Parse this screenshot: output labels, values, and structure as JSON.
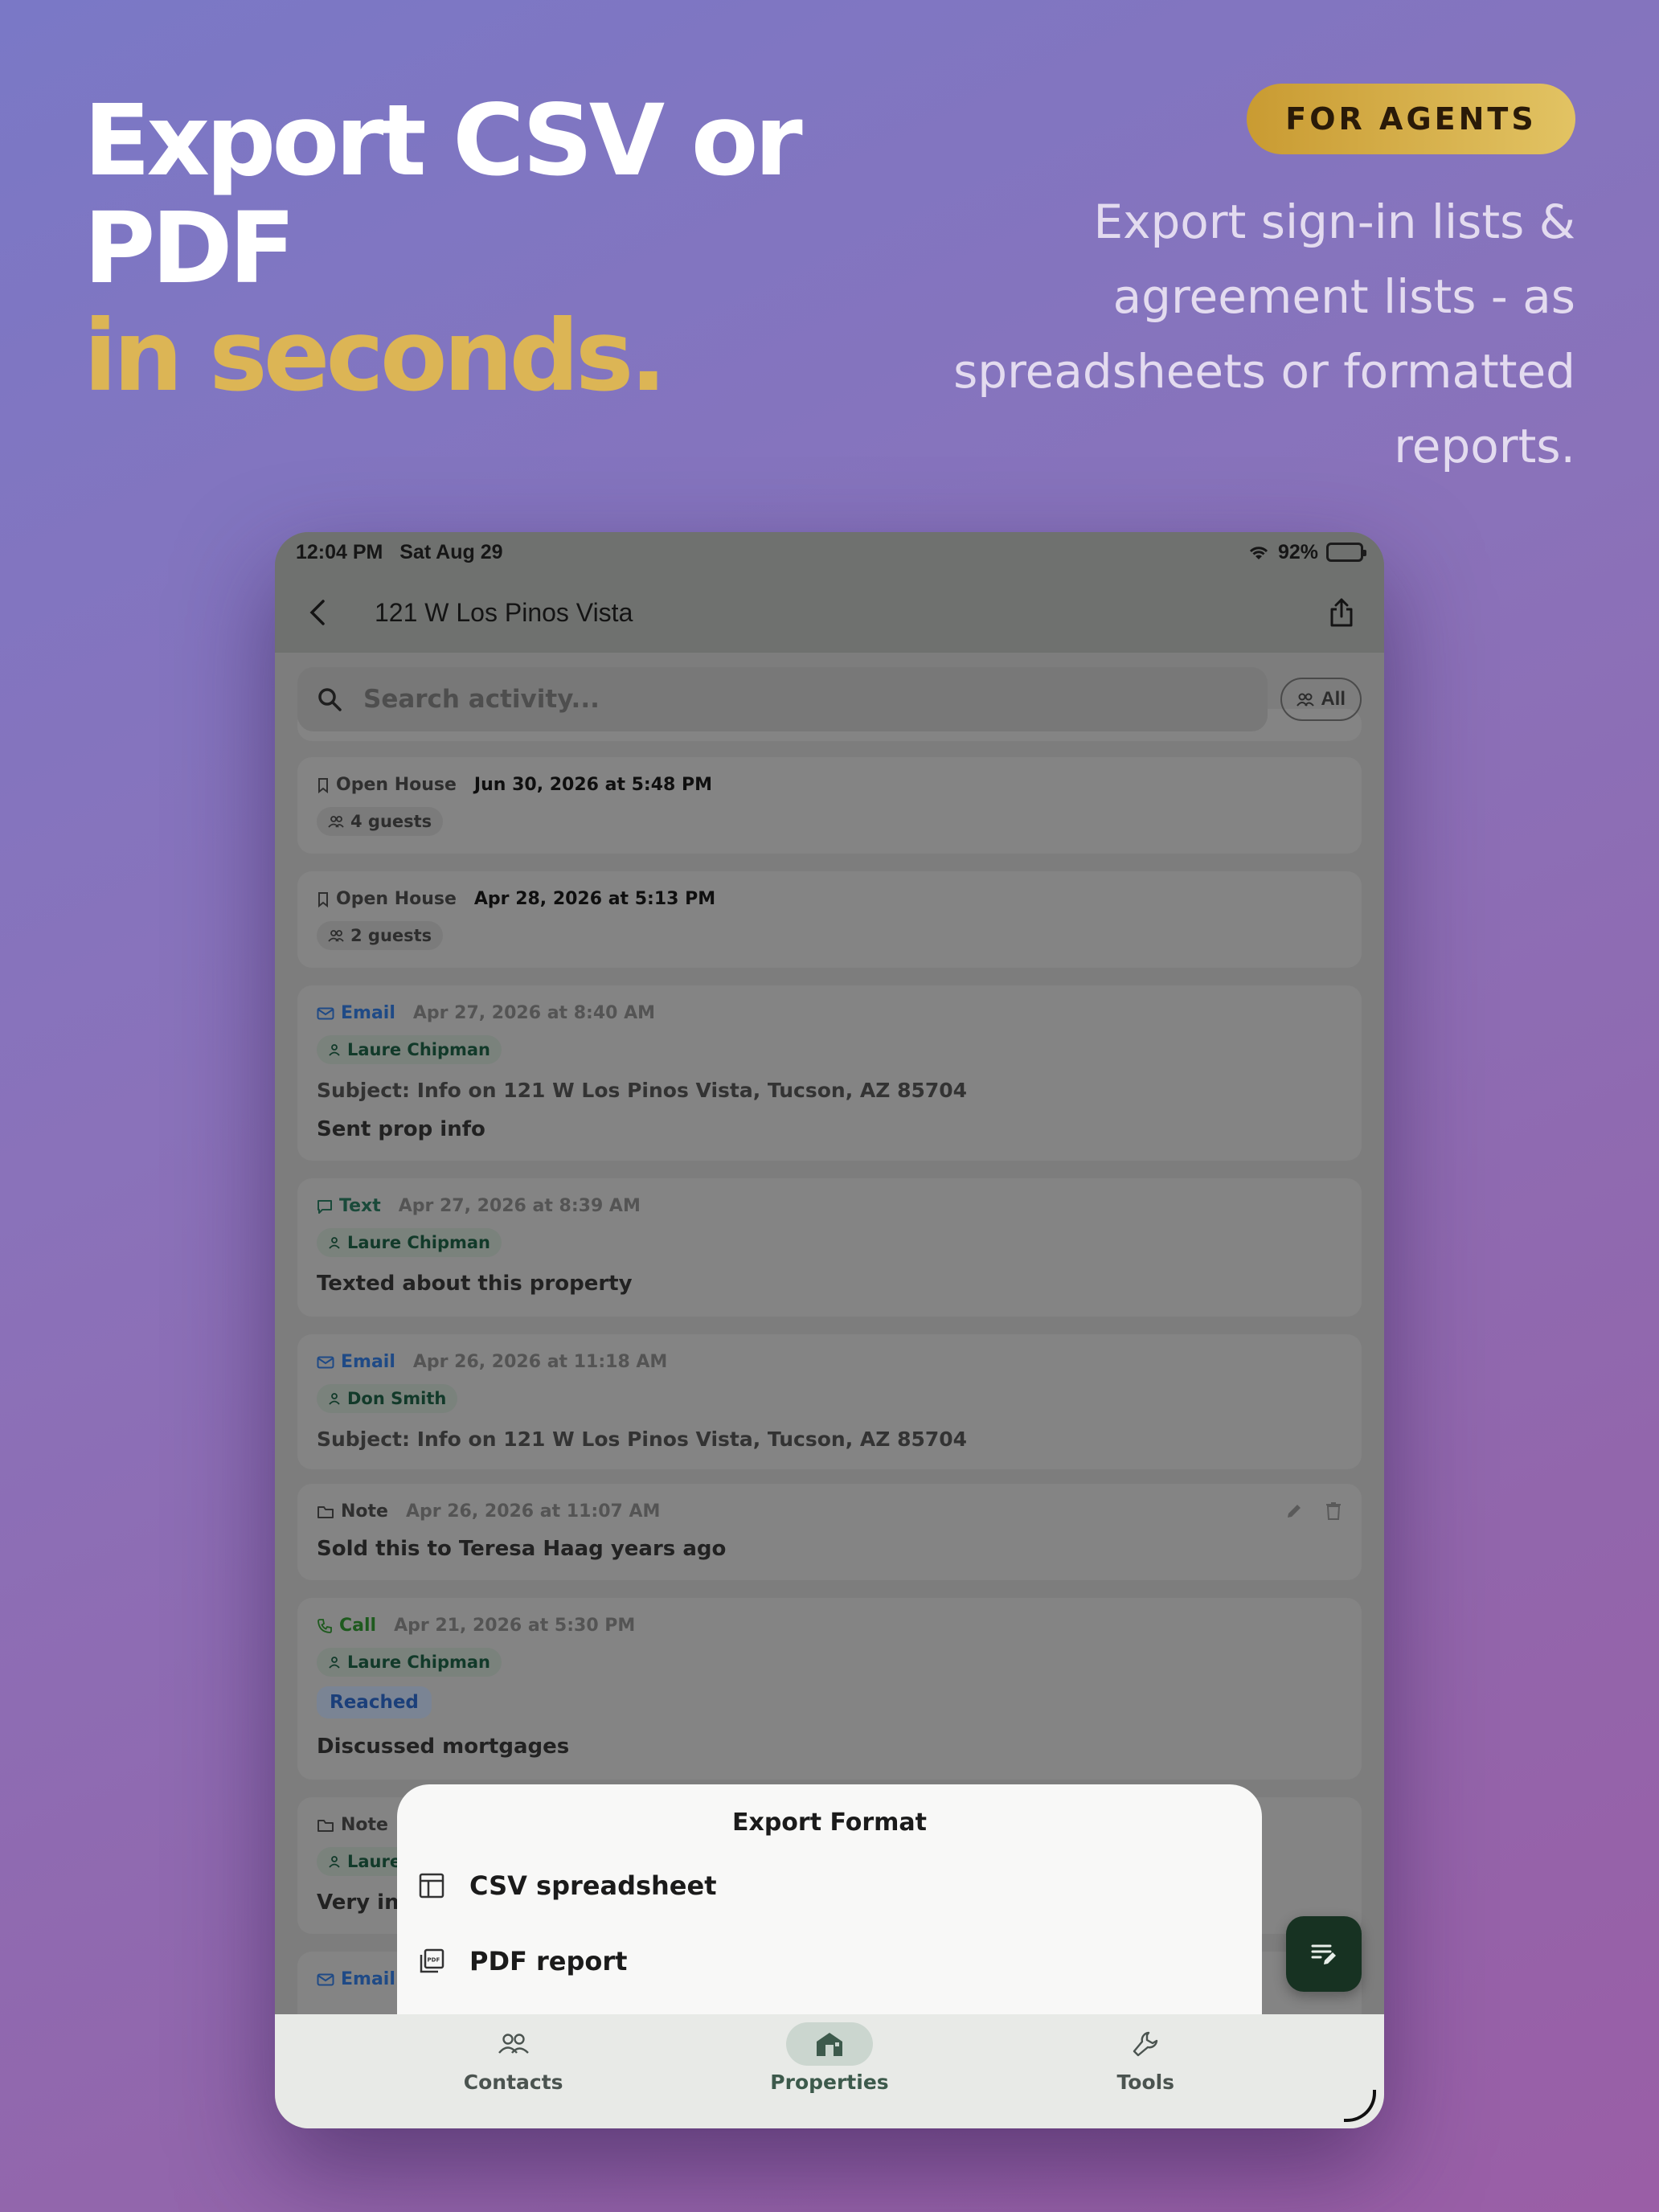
{
  "hero": {
    "title_line1": "Export CSV or",
    "title_line2": "PDF",
    "title_accent": "in seconds.",
    "badge": "FOR AGENTS",
    "subtitle": "Export sign-in lists & agreement lists - as spreadsheets or formatted reports."
  },
  "colors": {
    "accent_gold": "#dcb555",
    "fab_green": "#173222",
    "email_blue": "#1f4a86",
    "person_green": "#123a2a"
  },
  "status": {
    "time": "12:04 PM",
    "date": "Sat Aug 29",
    "battery": "92%"
  },
  "appbar": {
    "title": "121 W Los Pinos Vista"
  },
  "search": {
    "placeholder": "Search activity...",
    "filter_label": "All"
  },
  "feed": [
    {
      "type": "Open House",
      "date": "Jun 30, 2026 at 5:48 PM",
      "chip": "4 guests"
    },
    {
      "type": "Open House",
      "date": "Apr 28, 2026 at 5:13 PM",
      "chip": "2 guests"
    },
    {
      "type": "Email",
      "date": "Apr 27, 2026 at 8:40 AM",
      "person": "Laure Chipman",
      "subject": "Subject: Info on 121 W Los Pinos Vista, Tucson, AZ 85704",
      "body": "Sent prop info"
    },
    {
      "type": "Text",
      "date": "Apr 27, 2026 at 8:39 AM",
      "person": "Laure Chipman",
      "body": "Texted about this property"
    },
    {
      "type": "Email",
      "date": "Apr 26, 2026 at 11:18 AM",
      "person": "Don Smith",
      "subject": "Subject: Info on 121 W Los Pinos Vista, Tucson, AZ 85704"
    },
    {
      "type": "Note",
      "date": "Apr 26, 2026 at 11:07 AM",
      "body": "Sold this to Teresa Haag years ago"
    },
    {
      "type": "Call",
      "date": "Apr 21, 2026 at 5:30 PM",
      "person": "Laure Chipman",
      "outcome": "Reached",
      "body": "Discussed mortgages"
    },
    {
      "type": "Note",
      "person": "Laure",
      "body": "Very in"
    },
    {
      "type": "Email"
    }
  ],
  "sheet": {
    "title": "Export Format",
    "options": [
      "CSV spreadsheet",
      "PDF report"
    ]
  },
  "nav": {
    "items": [
      "Contacts",
      "Properties",
      "Tools"
    ],
    "active": "Properties"
  }
}
